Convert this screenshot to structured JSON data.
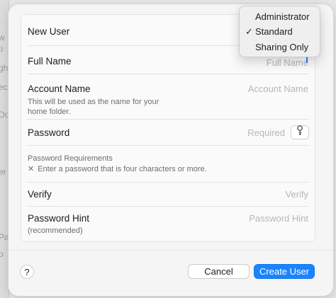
{
  "background_window": {
    "edge_letters": [
      "w",
      "ti",
      "gh",
      "ec",
      "Do",
      "er",
      "Pa",
      "o"
    ]
  },
  "form": {
    "new_user_label": "New User",
    "full_name_label": "Full Name",
    "full_name_placeholder": "Full Name",
    "account_name_label": "Account Name",
    "account_name_help_line1": "This will be used as the name for your",
    "account_name_help_line2": "home folder.",
    "account_name_placeholder": "Account Name",
    "password_label": "Password",
    "password_placeholder": "Required",
    "password_requirements_title": "Password Requirements",
    "password_requirement_text": "Enter a password that is four characters or more.",
    "verify_label": "Verify",
    "verify_placeholder": "Verify",
    "hint_label": "Password Hint",
    "hint_sublabel": "(recommended)",
    "hint_placeholder": "Password Hint"
  },
  "user_type_menu": {
    "items": [
      "Administrator",
      "Standard",
      "Sharing Only"
    ],
    "selected": "Standard",
    "check_glyph": "✓"
  },
  "footer": {
    "help_label": "?",
    "cancel_label": "Cancel",
    "create_label": "Create User"
  },
  "colors": {
    "accent": "#1a84ff",
    "placeholder": "#b6b6b8"
  },
  "icons": {
    "key_button": "key-icon",
    "requirement_status": "x-mark-icon"
  }
}
